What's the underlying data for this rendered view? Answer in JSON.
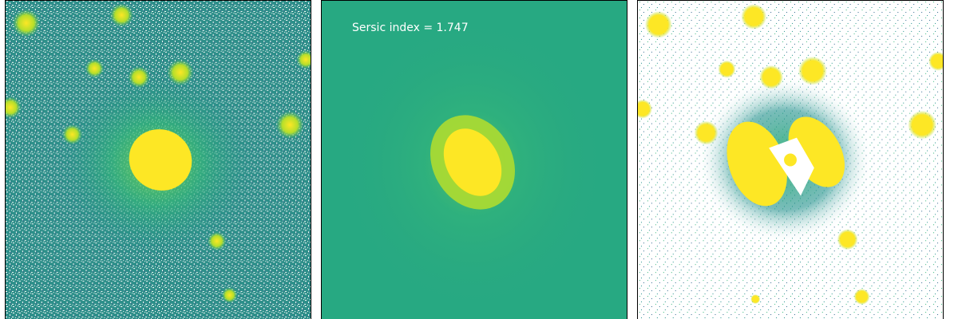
{
  "panels": [
    {
      "id": "data"
    },
    {
      "id": "model",
      "label": "Sersic index = 1.747"
    },
    {
      "id": "residual"
    }
  ],
  "colors": {
    "yellow": "#fde725",
    "teal": "#2a9d8f",
    "green": "#35b779",
    "blue": "#31688e",
    "white": "#ffffff"
  }
}
